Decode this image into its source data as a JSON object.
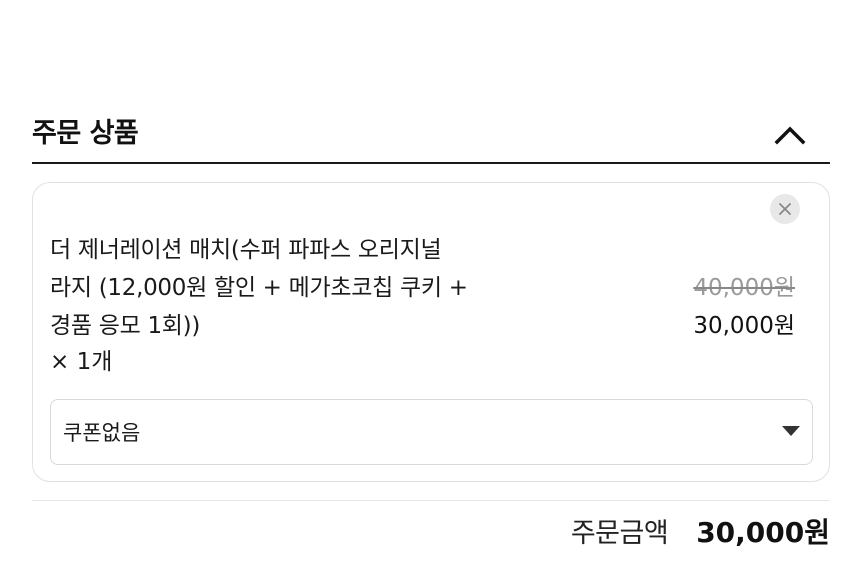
{
  "order_section": {
    "title": "주문 상품",
    "collapse_icon": "chevron-up-icon"
  },
  "product": {
    "remove_icon": "close-icon",
    "name_lines": [
      "더 제너레이션 매치(수퍼 파파스 오리지널",
      "라지 (12,000원 할인 + 메가초코칩 쿠키 +",
      "경품 응모 1회))"
    ],
    "quantity": "× 1개",
    "original_price": "40,000원",
    "sale_price": "30,000원"
  },
  "coupon": {
    "selected": "쿠폰없음",
    "dropdown_icon": "caret-down-icon"
  },
  "total": {
    "label": "주문금액",
    "amount": "30,000원"
  }
}
